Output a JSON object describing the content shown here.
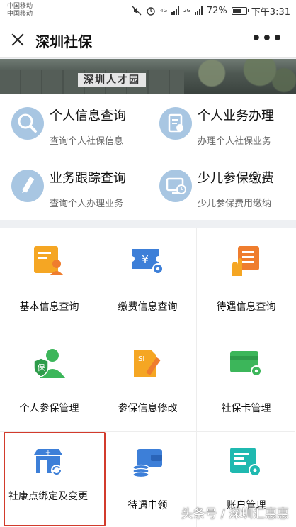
{
  "status_bar": {
    "carrier_1": "中国移动",
    "carrier_2": "中国移动",
    "network_1": "4G",
    "network_2": "2G",
    "battery": "72%",
    "battery_level": 0.72,
    "time": "下午3:31"
  },
  "header": {
    "title": "深圳社保",
    "more": "•••"
  },
  "banner": {
    "sign_text": "深圳人才园"
  },
  "quick_services": [
    {
      "title": "个人信息查询",
      "subtitle": "查询个人社保信息",
      "icon": "search-icon"
    },
    {
      "title": "个人业务办理",
      "subtitle": "办理个人社保业务",
      "icon": "document-icon"
    },
    {
      "title": "业务跟踪查询",
      "subtitle": "查询个人办理业务",
      "icon": "pen-icon"
    },
    {
      "title": "少儿参保缴费",
      "subtitle": "少儿参保费用缴纳",
      "icon": "monitor-clock-icon"
    }
  ],
  "services": [
    {
      "label": "基本信息查询",
      "icon": "user-info-icon"
    },
    {
      "label": "缴费信息查询",
      "icon": "yen-ticket-icon"
    },
    {
      "label": "待遇信息查询",
      "icon": "hand-checklist-icon"
    },
    {
      "label": "个人参保管理",
      "icon": "insured-person-icon"
    },
    {
      "label": "参保信息修改",
      "icon": "edit-document-icon"
    },
    {
      "label": "社保卡管理",
      "icon": "card-settings-icon"
    },
    {
      "label": "社康点绑定及变更",
      "icon": "clinic-sync-icon"
    },
    {
      "label": "待遇申领",
      "icon": "wallet-coins-icon"
    },
    {
      "label": "账户管理",
      "icon": "account-settings-icon"
    }
  ],
  "watermark": "头条号 / 深圳汇惠惠",
  "colors": {
    "orange": "#f5a623",
    "blue": "#3d7fd8",
    "green": "#3cb65a",
    "quick_icon_bg": "#a8c6e2",
    "highlight": "#d23b2c"
  }
}
